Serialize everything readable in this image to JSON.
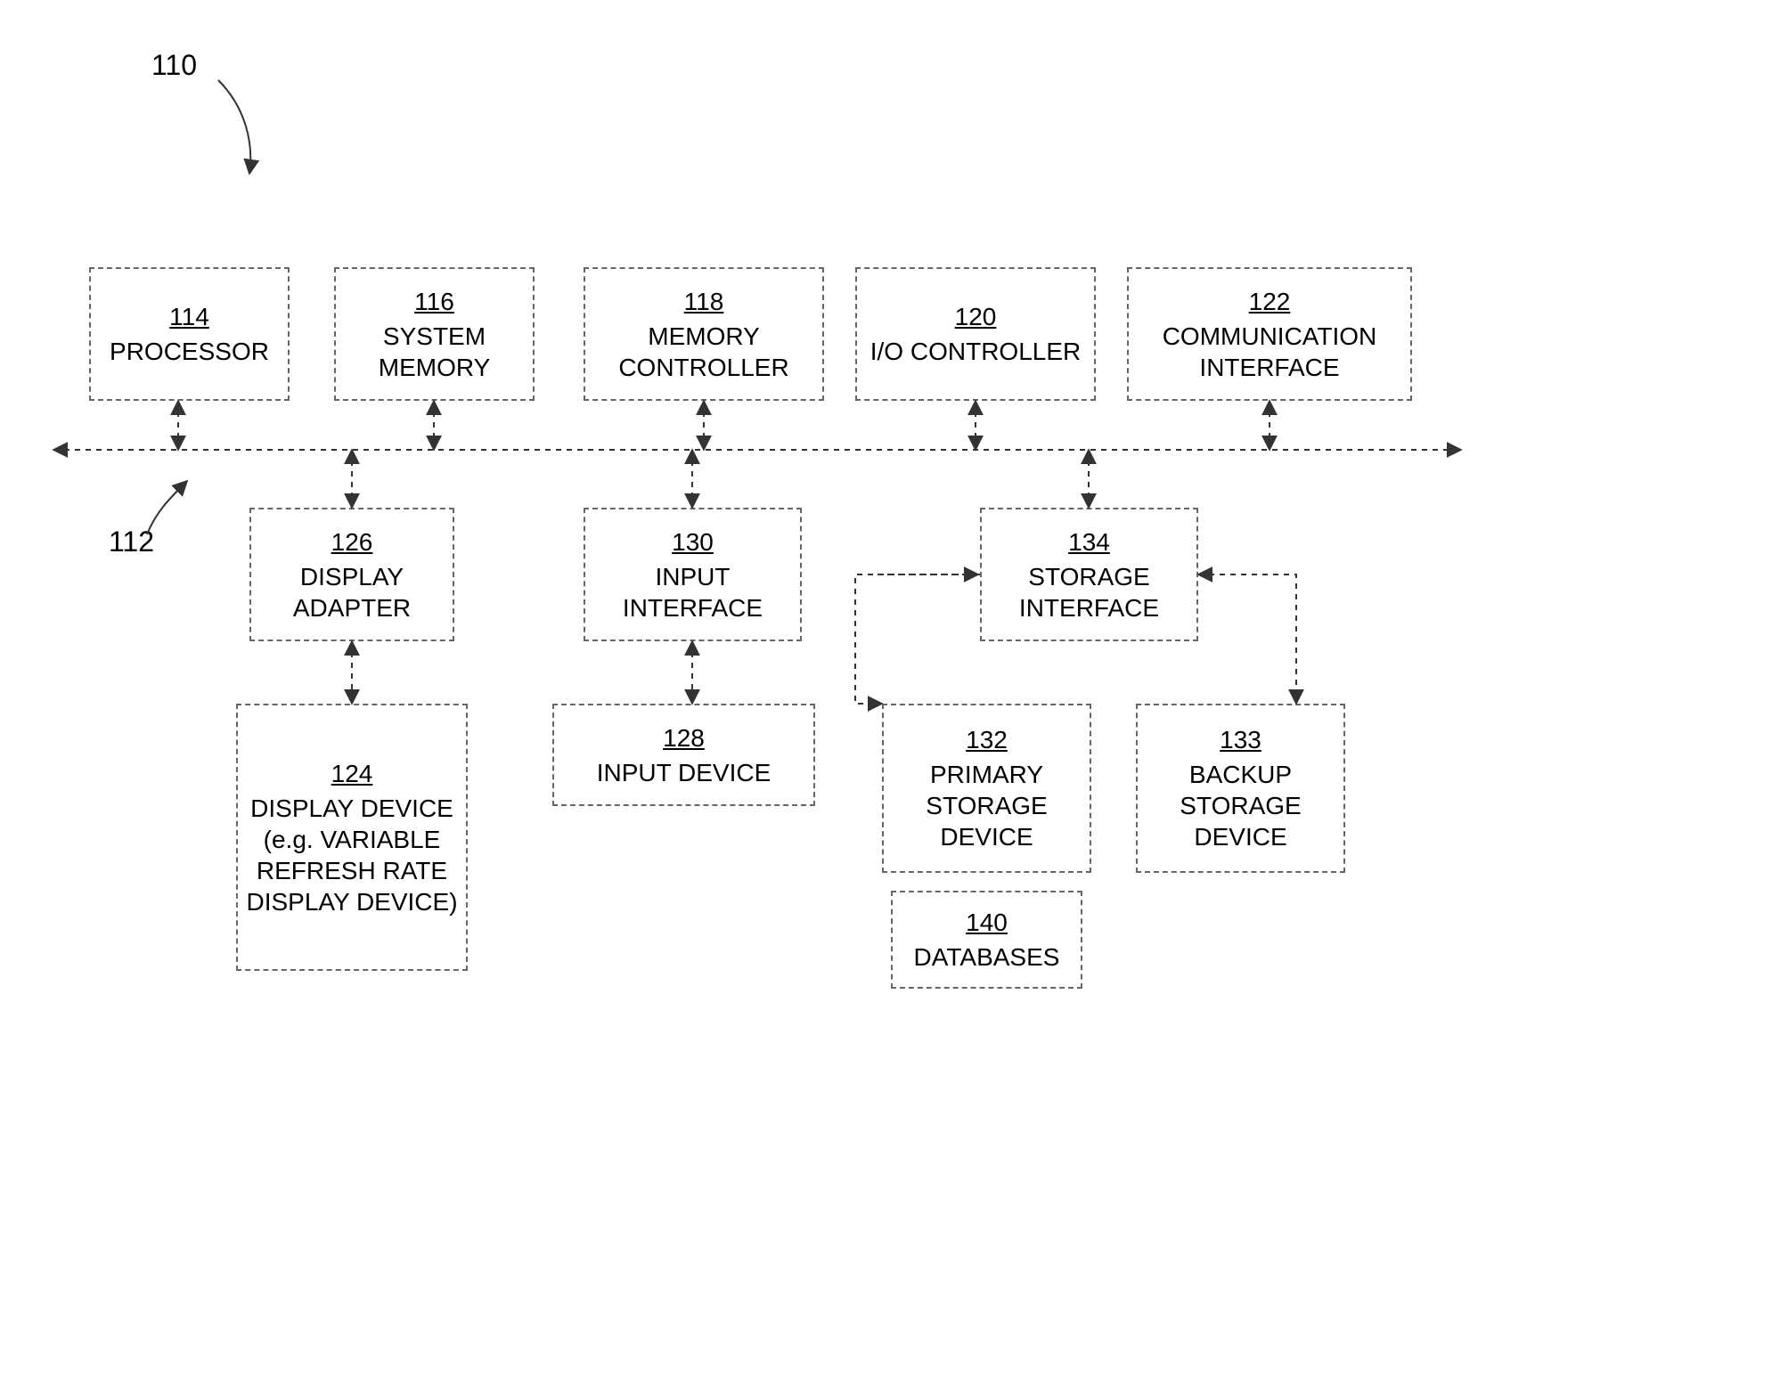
{
  "figureLabel": "110",
  "busLabel": "112",
  "blocks": {
    "processor": {
      "num": "114",
      "name": "PROCESSOR"
    },
    "sysmem": {
      "num": "116",
      "name": "SYSTEM MEMORY"
    },
    "memctrl": {
      "num": "118",
      "name": "MEMORY CONTROLLER"
    },
    "ioctrl": {
      "num": "120",
      "name": "I/O CONTROLLER"
    },
    "comm": {
      "num": "122",
      "name": "COMMUNICATION INTERFACE"
    },
    "dispadpt": {
      "num": "126",
      "name": "DISPLAY ADAPTER"
    },
    "inputif": {
      "num": "130",
      "name": "INPUT INTERFACE"
    },
    "storif": {
      "num": "134",
      "name": "STORAGE INTERFACE"
    },
    "dispdev": {
      "num": "124",
      "name": "DISPLAY DEVICE (e.g. VARIABLE REFRESH RATE DISPLAY DEVICE)"
    },
    "inputdev": {
      "num": "128",
      "name": "INPUT DEVICE"
    },
    "primstor": {
      "num": "132",
      "name": "PRIMARY STORAGE DEVICE"
    },
    "bkupstor": {
      "num": "133",
      "name": "BACKUP STORAGE DEVICE"
    },
    "databases": {
      "num": "140",
      "name": "DATABASES"
    }
  }
}
